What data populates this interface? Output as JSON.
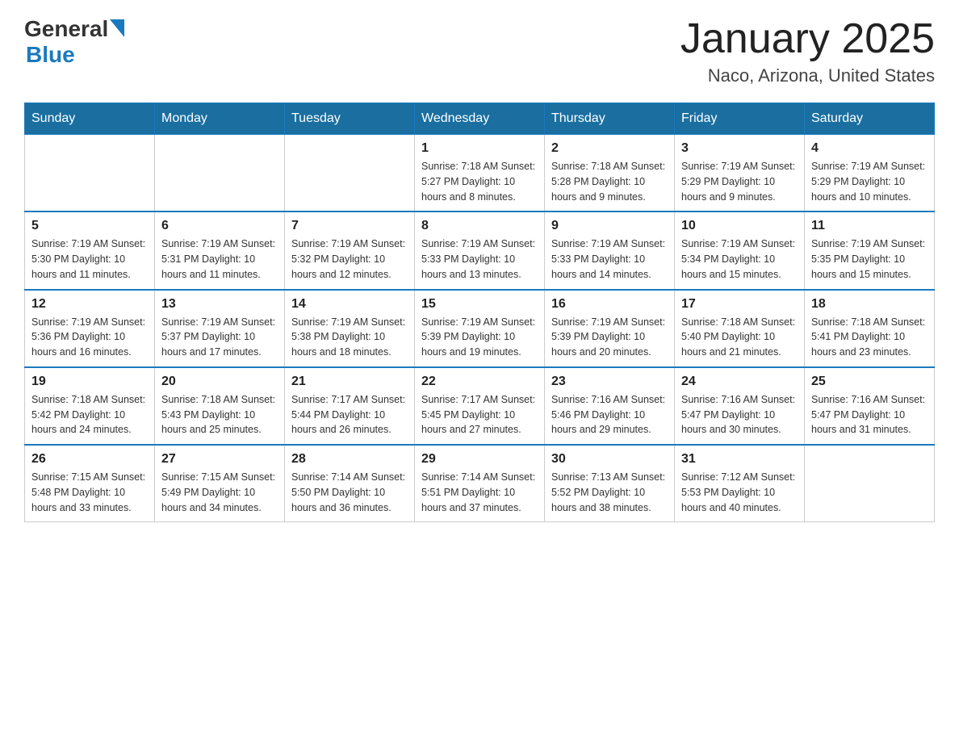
{
  "header": {
    "logo_general": "General",
    "logo_blue": "Blue",
    "month_title": "January 2025",
    "location": "Naco, Arizona, United States"
  },
  "days_of_week": [
    "Sunday",
    "Monday",
    "Tuesday",
    "Wednesday",
    "Thursday",
    "Friday",
    "Saturday"
  ],
  "weeks": [
    [
      {
        "day": "",
        "info": ""
      },
      {
        "day": "",
        "info": ""
      },
      {
        "day": "",
        "info": ""
      },
      {
        "day": "1",
        "info": "Sunrise: 7:18 AM\nSunset: 5:27 PM\nDaylight: 10 hours and 8 minutes."
      },
      {
        "day": "2",
        "info": "Sunrise: 7:18 AM\nSunset: 5:28 PM\nDaylight: 10 hours and 9 minutes."
      },
      {
        "day": "3",
        "info": "Sunrise: 7:19 AM\nSunset: 5:29 PM\nDaylight: 10 hours and 9 minutes."
      },
      {
        "day": "4",
        "info": "Sunrise: 7:19 AM\nSunset: 5:29 PM\nDaylight: 10 hours and 10 minutes."
      }
    ],
    [
      {
        "day": "5",
        "info": "Sunrise: 7:19 AM\nSunset: 5:30 PM\nDaylight: 10 hours and 11 minutes."
      },
      {
        "day": "6",
        "info": "Sunrise: 7:19 AM\nSunset: 5:31 PM\nDaylight: 10 hours and 11 minutes."
      },
      {
        "day": "7",
        "info": "Sunrise: 7:19 AM\nSunset: 5:32 PM\nDaylight: 10 hours and 12 minutes."
      },
      {
        "day": "8",
        "info": "Sunrise: 7:19 AM\nSunset: 5:33 PM\nDaylight: 10 hours and 13 minutes."
      },
      {
        "day": "9",
        "info": "Sunrise: 7:19 AM\nSunset: 5:33 PM\nDaylight: 10 hours and 14 minutes."
      },
      {
        "day": "10",
        "info": "Sunrise: 7:19 AM\nSunset: 5:34 PM\nDaylight: 10 hours and 15 minutes."
      },
      {
        "day": "11",
        "info": "Sunrise: 7:19 AM\nSunset: 5:35 PM\nDaylight: 10 hours and 15 minutes."
      }
    ],
    [
      {
        "day": "12",
        "info": "Sunrise: 7:19 AM\nSunset: 5:36 PM\nDaylight: 10 hours and 16 minutes."
      },
      {
        "day": "13",
        "info": "Sunrise: 7:19 AM\nSunset: 5:37 PM\nDaylight: 10 hours and 17 minutes."
      },
      {
        "day": "14",
        "info": "Sunrise: 7:19 AM\nSunset: 5:38 PM\nDaylight: 10 hours and 18 minutes."
      },
      {
        "day": "15",
        "info": "Sunrise: 7:19 AM\nSunset: 5:39 PM\nDaylight: 10 hours and 19 minutes."
      },
      {
        "day": "16",
        "info": "Sunrise: 7:19 AM\nSunset: 5:39 PM\nDaylight: 10 hours and 20 minutes."
      },
      {
        "day": "17",
        "info": "Sunrise: 7:18 AM\nSunset: 5:40 PM\nDaylight: 10 hours and 21 minutes."
      },
      {
        "day": "18",
        "info": "Sunrise: 7:18 AM\nSunset: 5:41 PM\nDaylight: 10 hours and 23 minutes."
      }
    ],
    [
      {
        "day": "19",
        "info": "Sunrise: 7:18 AM\nSunset: 5:42 PM\nDaylight: 10 hours and 24 minutes."
      },
      {
        "day": "20",
        "info": "Sunrise: 7:18 AM\nSunset: 5:43 PM\nDaylight: 10 hours and 25 minutes."
      },
      {
        "day": "21",
        "info": "Sunrise: 7:17 AM\nSunset: 5:44 PM\nDaylight: 10 hours and 26 minutes."
      },
      {
        "day": "22",
        "info": "Sunrise: 7:17 AM\nSunset: 5:45 PM\nDaylight: 10 hours and 27 minutes."
      },
      {
        "day": "23",
        "info": "Sunrise: 7:16 AM\nSunset: 5:46 PM\nDaylight: 10 hours and 29 minutes."
      },
      {
        "day": "24",
        "info": "Sunrise: 7:16 AM\nSunset: 5:47 PM\nDaylight: 10 hours and 30 minutes."
      },
      {
        "day": "25",
        "info": "Sunrise: 7:16 AM\nSunset: 5:47 PM\nDaylight: 10 hours and 31 minutes."
      }
    ],
    [
      {
        "day": "26",
        "info": "Sunrise: 7:15 AM\nSunset: 5:48 PM\nDaylight: 10 hours and 33 minutes."
      },
      {
        "day": "27",
        "info": "Sunrise: 7:15 AM\nSunset: 5:49 PM\nDaylight: 10 hours and 34 minutes."
      },
      {
        "day": "28",
        "info": "Sunrise: 7:14 AM\nSunset: 5:50 PM\nDaylight: 10 hours and 36 minutes."
      },
      {
        "day": "29",
        "info": "Sunrise: 7:14 AM\nSunset: 5:51 PM\nDaylight: 10 hours and 37 minutes."
      },
      {
        "day": "30",
        "info": "Sunrise: 7:13 AM\nSunset: 5:52 PM\nDaylight: 10 hours and 38 minutes."
      },
      {
        "day": "31",
        "info": "Sunrise: 7:12 AM\nSunset: 5:53 PM\nDaylight: 10 hours and 40 minutes."
      },
      {
        "day": "",
        "info": ""
      }
    ]
  ]
}
